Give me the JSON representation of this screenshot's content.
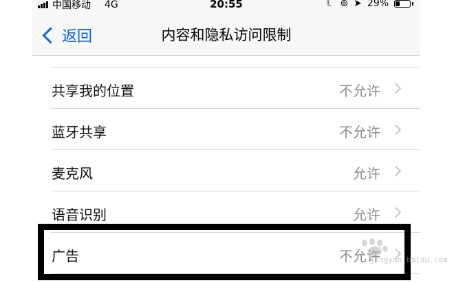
{
  "status_bar": {
    "carrier": "中国移动",
    "network": "4G",
    "time": "20:55",
    "battery_percent": "29%"
  },
  "nav": {
    "back_label": "返回",
    "title": "内容和隐私访问限制"
  },
  "rows": [
    {
      "label": "共享我的位置",
      "value": "不允许"
    },
    {
      "label": "蓝牙共享",
      "value": "不允许"
    },
    {
      "label": "麦克风",
      "value": "允许"
    },
    {
      "label": "语音识别",
      "value": "允许"
    },
    {
      "label": "广告",
      "value": "不允许"
    }
  ],
  "watermark": {
    "text": "jingyan.baidu.com"
  },
  "colors": {
    "accent": "#0a63d9",
    "secondary_text": "#8e8e93",
    "separator": "#d4d4d8",
    "nav_background": "#f7f7f7"
  }
}
